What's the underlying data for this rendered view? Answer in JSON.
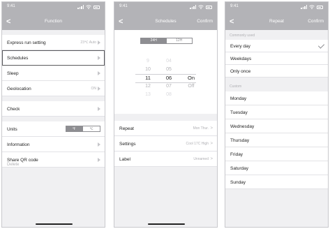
{
  "status": {
    "time": "9:41"
  },
  "function": {
    "title": "Function",
    "rows": [
      {
        "label": "Express run setting",
        "value": "23℃ Auto"
      },
      {
        "label": "Schedules"
      },
      {
        "label": "Sleep"
      },
      {
        "label": "Geolocation",
        "value": "ON"
      },
      {
        "label": "Check"
      },
      {
        "label": "Units",
        "toggle": [
          "℉",
          "℃"
        ]
      },
      {
        "label": "Information"
      },
      {
        "label": "Share QR code"
      }
    ],
    "delete_label": "Delete"
  },
  "schedules": {
    "title": "Schedules",
    "confirm": "Confirm",
    "format_options": [
      "24H",
      "12H"
    ],
    "selected_format": "12H",
    "hours": [
      "9",
      "10",
      "11",
      "12",
      "13"
    ],
    "minutes": [
      "04",
      "05",
      "06",
      "07",
      "08"
    ],
    "modes": [
      "On",
      "Off"
    ],
    "rows": [
      {
        "label": "Repeat",
        "value": "Mon Thur."
      },
      {
        "label": "Settings",
        "value": "Cool 17C High"
      },
      {
        "label": "Label",
        "value": "Unnamed"
      }
    ]
  },
  "repeat": {
    "title": "Repeat",
    "confirm": "Confirm",
    "common_header": "Commonly used",
    "common": [
      "Every day",
      "Weekdays",
      "Only once"
    ],
    "custom_header": "Custom",
    "days": [
      "Monday",
      "Tuesday",
      "Wednesday",
      "Thursday",
      "Friday",
      "Saturday",
      "Sunday"
    ]
  }
}
